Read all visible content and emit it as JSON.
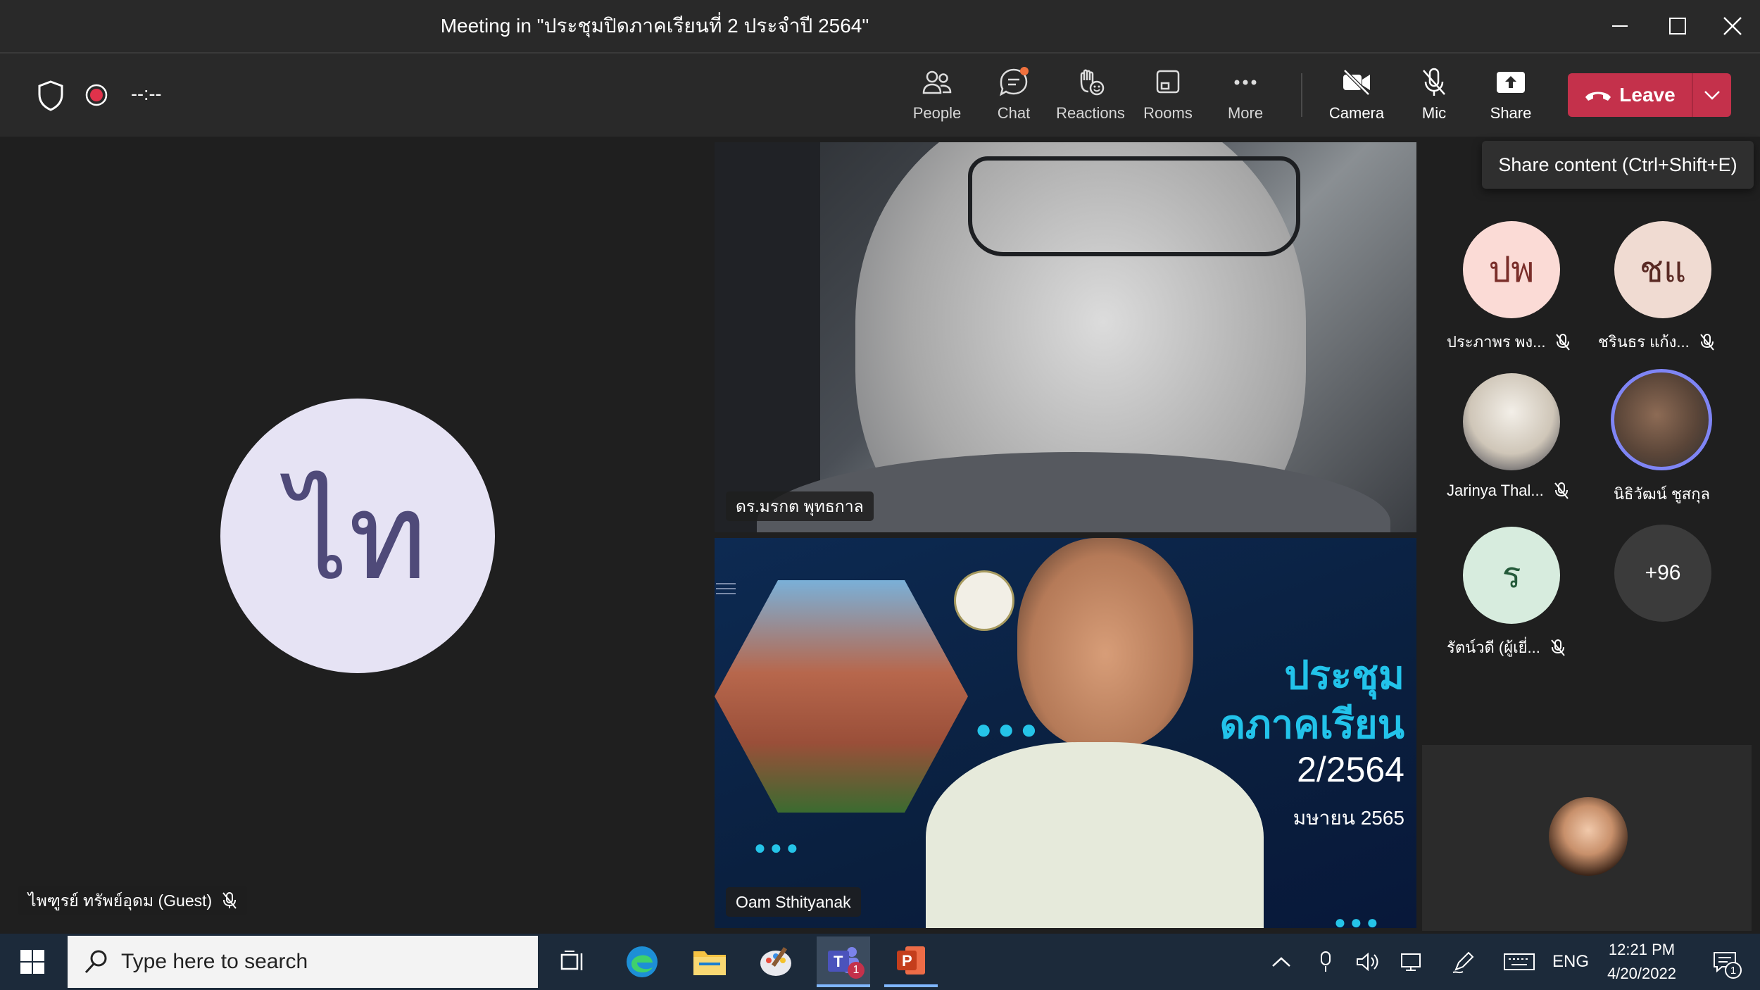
{
  "window": {
    "title": "Meeting in \"ประชุมปิดภาคเรียนที่ 2 ประจำปี 2564\""
  },
  "toolbar": {
    "timer": "--:--",
    "items": [
      {
        "label": "People",
        "icon": "people-icon"
      },
      {
        "label": "Chat",
        "icon": "chat-icon"
      },
      {
        "label": "Reactions",
        "icon": "reactions-icon"
      },
      {
        "label": "Rooms",
        "icon": "rooms-icon"
      },
      {
        "label": "More",
        "icon": "more-icon"
      },
      {
        "label": "Camera",
        "icon": "camera-off-icon"
      },
      {
        "label": "Mic",
        "icon": "mic-off-icon"
      },
      {
        "label": "Share",
        "icon": "share-icon"
      }
    ],
    "leave_label": "Leave",
    "share_tooltip": "Share content (Ctrl+Shift+E)"
  },
  "stage": {
    "main_avatar_initials": "ไท",
    "main_participant": "ไพฑูรย์ ทรัพย์อุดม (Guest)",
    "video1_name": "ดร.มรกต พุทธกาล",
    "video2_name": "Oam Sthityanak",
    "slide": {
      "line1": "ประชุม",
      "line2": "ดภาคเรียน",
      "line3": "2/2564",
      "line4": "มษายน 2565"
    }
  },
  "roster": {
    "participants": [
      {
        "initials": "ปพ",
        "name": "ประภาพร พง...",
        "muted": true
      },
      {
        "initials": "ชแ",
        "name": "ชรินธร แก้ง...",
        "muted": true
      },
      {
        "initials": "",
        "name": "Jarinya Thal...",
        "muted": true
      },
      {
        "initials": "",
        "name": "นิธิวัฒน์ ชูสกุล",
        "muted": false
      },
      {
        "initials": "ร",
        "name": "รัตน์วดี (ผู้เยี่...",
        "muted": true
      }
    ],
    "overflow": "+96"
  },
  "taskbar": {
    "search_placeholder": "Type here to search",
    "language": "ENG",
    "time": "12:21 PM",
    "date": "4/20/2022",
    "teams_badge": "1",
    "notif_badge": "1"
  },
  "colors": {
    "leave": "#c4314b",
    "record": "#e0324b",
    "chat_badge": "#f0713e",
    "accent_ring": "#7f85f5"
  }
}
